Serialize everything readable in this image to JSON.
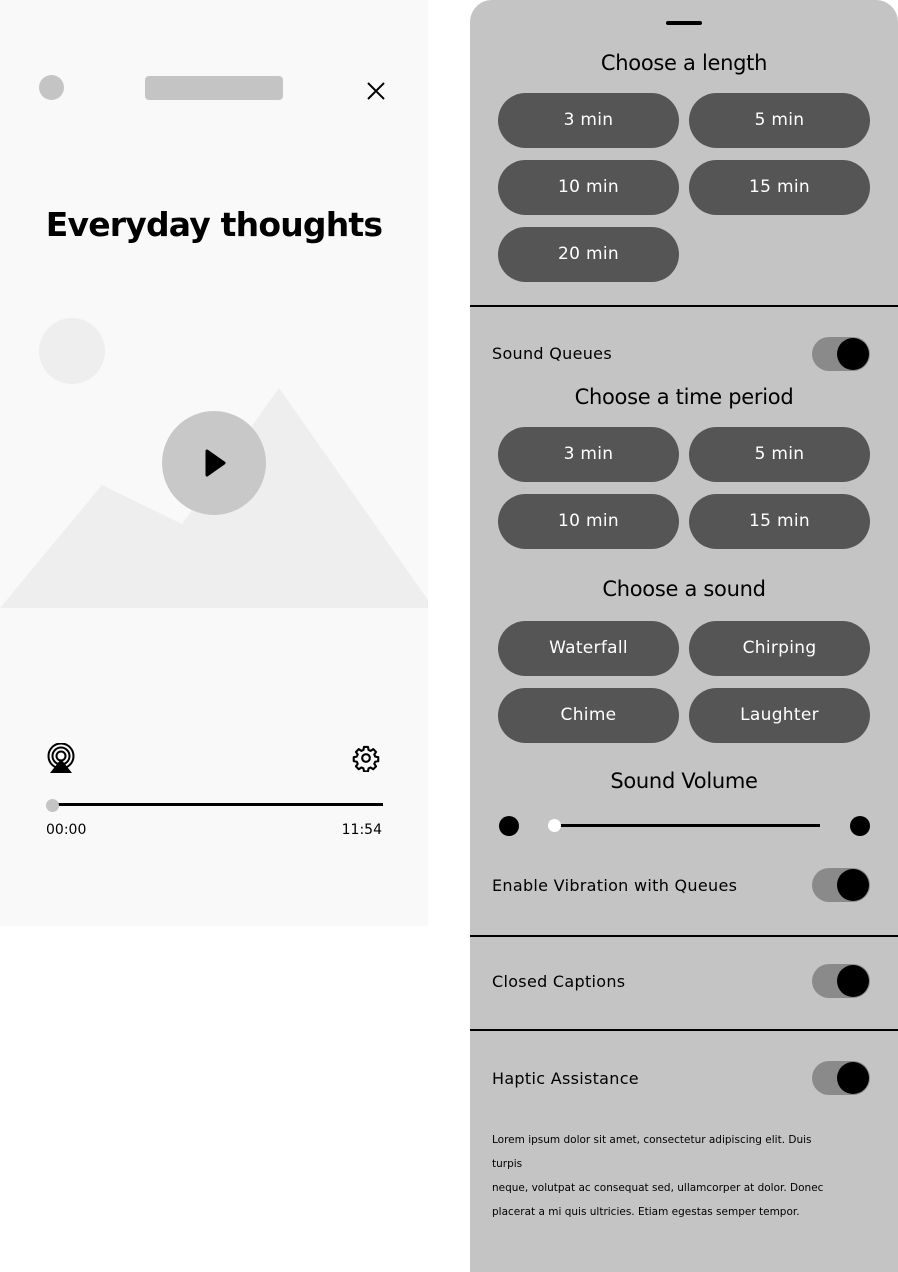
{
  "player": {
    "title": "Everyday thoughts",
    "time_current": "00:00",
    "time_total": "11:54",
    "progress": 0,
    "icons": {
      "close": "close-icon",
      "play": "play-icon",
      "airplay": "airplay-icon",
      "settings": "gear-icon"
    }
  },
  "settings": {
    "length": {
      "heading": "Choose a length",
      "options": [
        "3 min",
        "5 min",
        "10 min",
        "15 min",
        "20 min"
      ]
    },
    "sound_queues": {
      "label": "Sound Queues",
      "enabled": true
    },
    "time_period": {
      "heading": "Choose a time period",
      "options": [
        "3 min",
        "5 min",
        "10 min",
        "15 min"
      ]
    },
    "sound": {
      "heading": "Choose a sound",
      "options": [
        "Waterfall",
        "Chirping",
        "Chime",
        "Laughter"
      ]
    },
    "volume": {
      "heading": "Sound Volume",
      "level": 0
    },
    "vibration": {
      "label": "Enable Vibration with Queues",
      "enabled": true
    },
    "captions": {
      "label": "Closed Captions",
      "enabled": true
    },
    "haptic": {
      "label": "Haptic Assistance",
      "enabled": true,
      "description_lines": [
        "Lorem ipsum dolor sit amet, consectetur adipiscing elit. Duis turpis",
        "neque, volutpat ac consequat sed, ullamcorper at dolor. Donec",
        "placerat a mi quis ultricies. Etiam egestas semper tempor."
      ]
    }
  },
  "colors": {
    "sheet_bg": "#c4c4c4",
    "pill_bg": "#555555",
    "player_bg": "#f9f9f9",
    "toggle_track": "#8a8a8a"
  }
}
